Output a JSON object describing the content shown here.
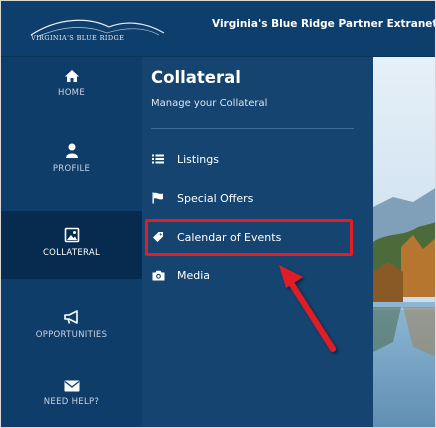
{
  "header": {
    "logo_text": "VIRGINIA'S BLUE RIDGE",
    "title": "Virginia's Blue Ridge Partner Extranet"
  },
  "nav": {
    "items": [
      {
        "label": "HOME",
        "icon": "home-icon"
      },
      {
        "label": "PROFILE",
        "icon": "user-icon"
      },
      {
        "label": "COLLATERAL",
        "icon": "image-icon",
        "active": true
      },
      {
        "label": "OPPORTUNITIES",
        "icon": "megaphone-icon"
      },
      {
        "label": "NEED HELP?",
        "icon": "envelope-icon"
      }
    ]
  },
  "submenu": {
    "title": "Collateral",
    "subtitle": "Manage your Collateral",
    "items": [
      {
        "label": "Listings",
        "icon": "list-icon"
      },
      {
        "label": "Special Offers",
        "icon": "flag-icon"
      },
      {
        "label": "Calendar of Events",
        "icon": "tag-icon",
        "highlighted": true
      },
      {
        "label": "Media",
        "icon": "camera-icon"
      }
    ]
  },
  "colors": {
    "header_bg": "#0e3e6b",
    "nav_bg": "#0f3d69",
    "nav_active_bg": "#062b4f",
    "submenu_bg": "#154470",
    "highlight": "#e01e25"
  }
}
